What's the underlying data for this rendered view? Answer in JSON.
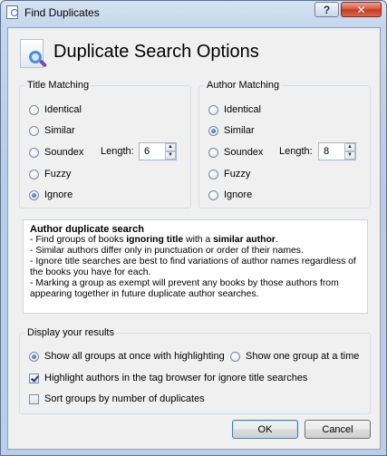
{
  "window": {
    "title": "Find Duplicates",
    "help_label": "?",
    "close_label": "✕"
  },
  "header": {
    "title": "Duplicate Search Options",
    "icon": "search-book-icon"
  },
  "title_matching": {
    "legend": "Title Matching",
    "options": [
      "Identical",
      "Similar",
      "Soundex",
      "Fuzzy",
      "Ignore"
    ],
    "selected": "Ignore",
    "length_label": "Length:",
    "length_value": "6"
  },
  "author_matching": {
    "legend": "Author Matching",
    "options": [
      "Identical",
      "Similar",
      "Soundex",
      "Fuzzy",
      "Ignore"
    ],
    "selected": "Similar",
    "length_label": "Length:",
    "length_value": "8"
  },
  "description": {
    "title": "Author duplicate search",
    "line1_prefix": "- Find groups of books ",
    "line1_bold1": "ignoring title",
    "line1_mid": " with a ",
    "line1_bold2": "similar author",
    "line1_suffix": ".",
    "line2": "- Similar authors differ only in punctuation or order of their names.",
    "line3": "- Ignore title searches are best to find variations of author names regardless of the books you have for each.",
    "line4": "- Marking a group as exempt will prevent any books by those authors from appearing together in future duplicate author searches."
  },
  "display": {
    "legend": "Display your results",
    "show_all_label": "Show all groups at once with highlighting",
    "show_one_label": "Show one group at a time",
    "show_mode": "all",
    "highlight_label": "Highlight authors in the tag browser for ignore title searches",
    "highlight_checked": true,
    "sort_label": "Sort groups by number of duplicates",
    "sort_checked": false
  },
  "buttons": {
    "ok": "OK",
    "cancel": "Cancel"
  }
}
